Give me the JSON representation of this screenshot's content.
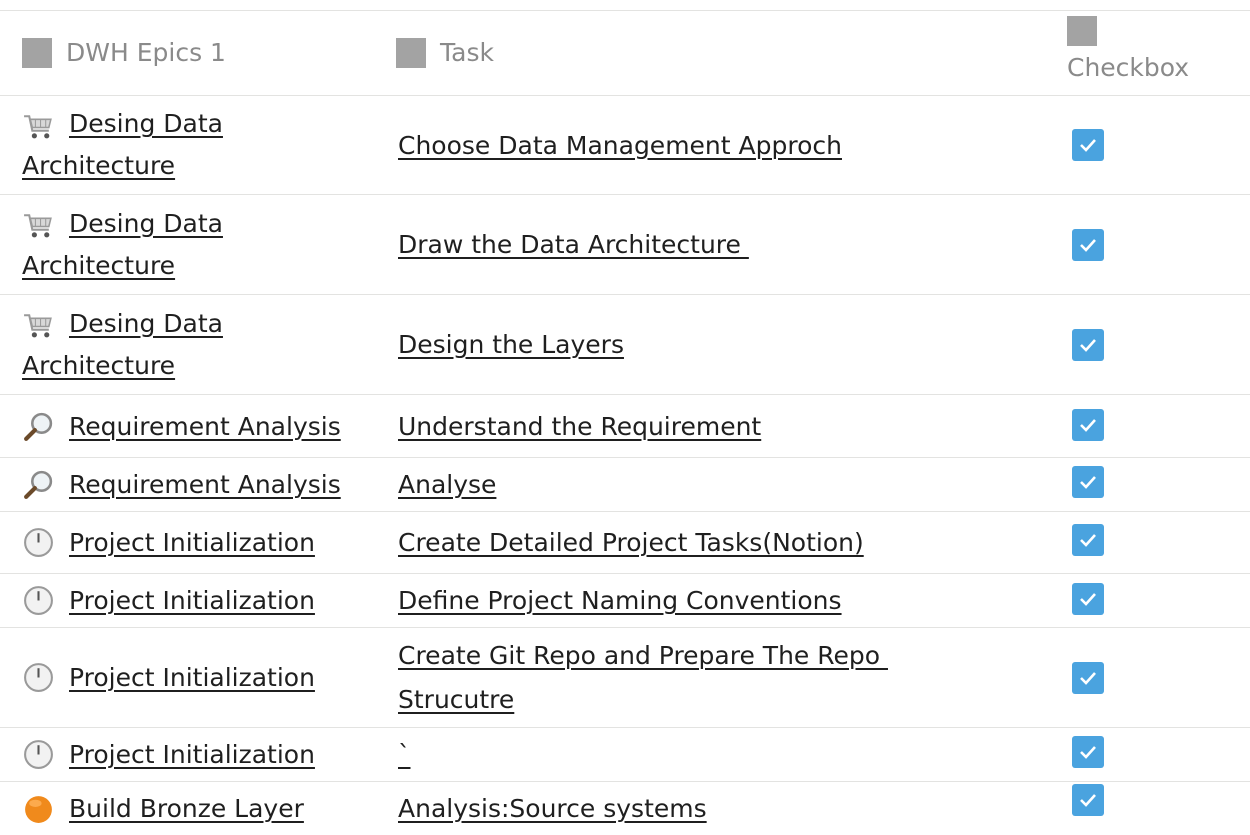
{
  "headers": {
    "epic": "DWH Epics 1",
    "task": "Task",
    "checkbox": "Checkbox"
  },
  "rows": [
    {
      "epic": "Desing Data Architecture",
      "epic_line1": "Desing Data ",
      "epic_line2": "Architecture",
      "icon": "shopping-cart-icon",
      "task": "Choose Data Management Approch",
      "checked": true
    },
    {
      "epic": "Desing Data Architecture",
      "epic_line1": "Desing Data ",
      "epic_line2": "Architecture",
      "icon": "shopping-cart-icon",
      "task": "Draw the Data Architecture ",
      "checked": true
    },
    {
      "epic": "Desing Data Architecture",
      "epic_line1": "Desing Data ",
      "epic_line2": "Architecture",
      "icon": "shopping-cart-icon",
      "task": "Design the Layers",
      "checked": true
    },
    {
      "epic": "Requirement Analysis",
      "icon": "magnifying-glass-icon",
      "task": "Understand the Requirement",
      "checked": true
    },
    {
      "epic": "Requirement Analysis",
      "icon": "magnifying-glass-icon",
      "task": "Analyse",
      "checked": true
    },
    {
      "epic": "Project Initialization",
      "icon": "clock-icon",
      "task": "Create Detailed Project Tasks(Notion)",
      "checked": true
    },
    {
      "epic": "Project Initialization",
      "icon": "clock-icon",
      "task": "Define Project Naming Conventions",
      "checked": true
    },
    {
      "epic": "Project Initialization",
      "icon": "clock-icon",
      "task": "Create Git Repo and Prepare The Repo Strucutre",
      "task_line1": "Create Git Repo and Prepare The Repo ",
      "task_line2": "Strucutre",
      "checked": true
    },
    {
      "epic": "Project Initialization",
      "icon": "clock-icon",
      "task": "`",
      "checked": true
    },
    {
      "epic": "Build Bronze Layer",
      "icon": "orange-circle-icon",
      "task": "Analysis:Source systems",
      "checked": true
    }
  ],
  "colors": {
    "checkbox_fill": "#4aa3df",
    "grid_line": "#e3e3e1",
    "header_text": "#8a8a8a",
    "header_icon": "#a3a3a3"
  }
}
